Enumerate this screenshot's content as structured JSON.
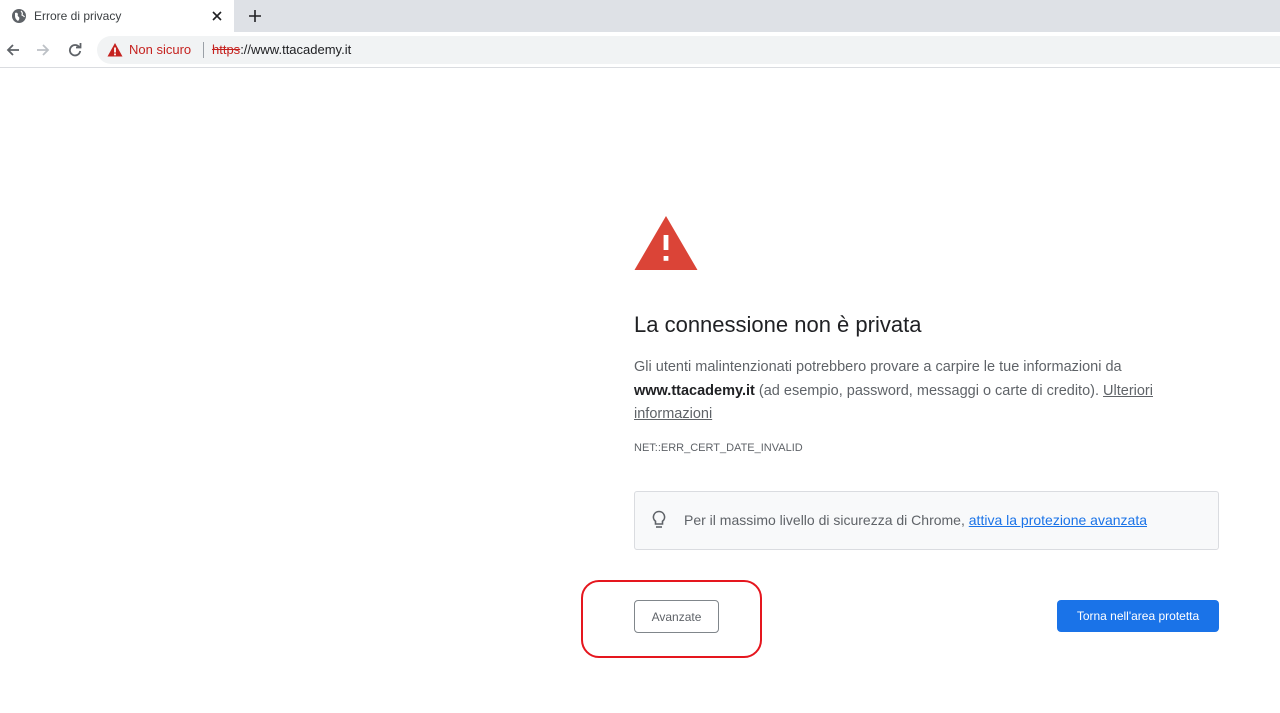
{
  "browser": {
    "tab": {
      "title": "Errore di privacy",
      "close_icon": "close-icon",
      "favicon": "globe-icon"
    },
    "new_tab_icon": "plus-icon",
    "nav": {
      "back_icon": "arrow-left-icon",
      "forward_icon": "arrow-right-icon",
      "reload_icon": "reload-icon"
    },
    "omnibox": {
      "security_label": "Non sicuro",
      "url_scheme": "https",
      "url_rest": "://www.ttacademy.it"
    }
  },
  "interstitial": {
    "heading": "La connessione non è privata",
    "explanation_part1": "Gli utenti malintenzionati potrebbero provare a carpire le tue informazioni da ",
    "domain": "www.ttacademy.it",
    "explanation_part2": " (ad esempio, password, messaggi o carte di credito). ",
    "learn_more": "Ulteriori informazioni",
    "error_code": "NET::ERR_CERT_DATE_INVALID",
    "enhanced_protection": {
      "text": "Per il massimo livello di sicurezza di Chrome, ",
      "link": "attiva la protezione avanzata"
    },
    "buttons": {
      "advanced": "Avanzate",
      "back_to_safety": "Torna nell'area protetta"
    }
  },
  "colors": {
    "warning_red": "#db4437",
    "not_secure_red": "#c5221f",
    "primary_blue": "#1a73e8",
    "annotation_ring": "#e5161e"
  }
}
